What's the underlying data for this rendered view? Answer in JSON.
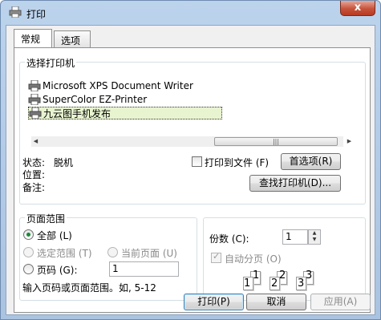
{
  "window": {
    "title": "打印",
    "close_symbol": "x"
  },
  "tabs": [
    "常规",
    "选项"
  ],
  "select_printer": {
    "label": "选择打印机",
    "printers": [
      "Microsoft XPS Document Writer",
      "SuperColor EZ-Printer",
      "九云图手机发布"
    ],
    "selected_index": 2,
    "scroll_grip": "|||"
  },
  "status": {
    "status_label": "状态:",
    "status_value": "脱机",
    "location_label": "位置:",
    "comment_label": "备注:",
    "print_to_file_label": "打印到文件 (F)",
    "preferences_button": "首选项(R)",
    "find_printer_button": "查找打印机(D)..."
  },
  "page_range": {
    "label": "页面范围",
    "all": "全部 (L)",
    "selection": "选定范围 (T)",
    "current_page": "当前页面 (U)",
    "pages": "页码 (G):",
    "pages_value": "1",
    "hint": "输入页码或页面范围。如, 5-12"
  },
  "copies": {
    "label": "份数 (C):",
    "value": "1",
    "collate": "自动分页 (O)",
    "collate_numbers": [
      "1",
      "1",
      "2",
      "2",
      "3",
      "3"
    ]
  },
  "buttons": {
    "print": "打印(P)",
    "cancel": "取消",
    "apply": "应用(A)"
  }
}
